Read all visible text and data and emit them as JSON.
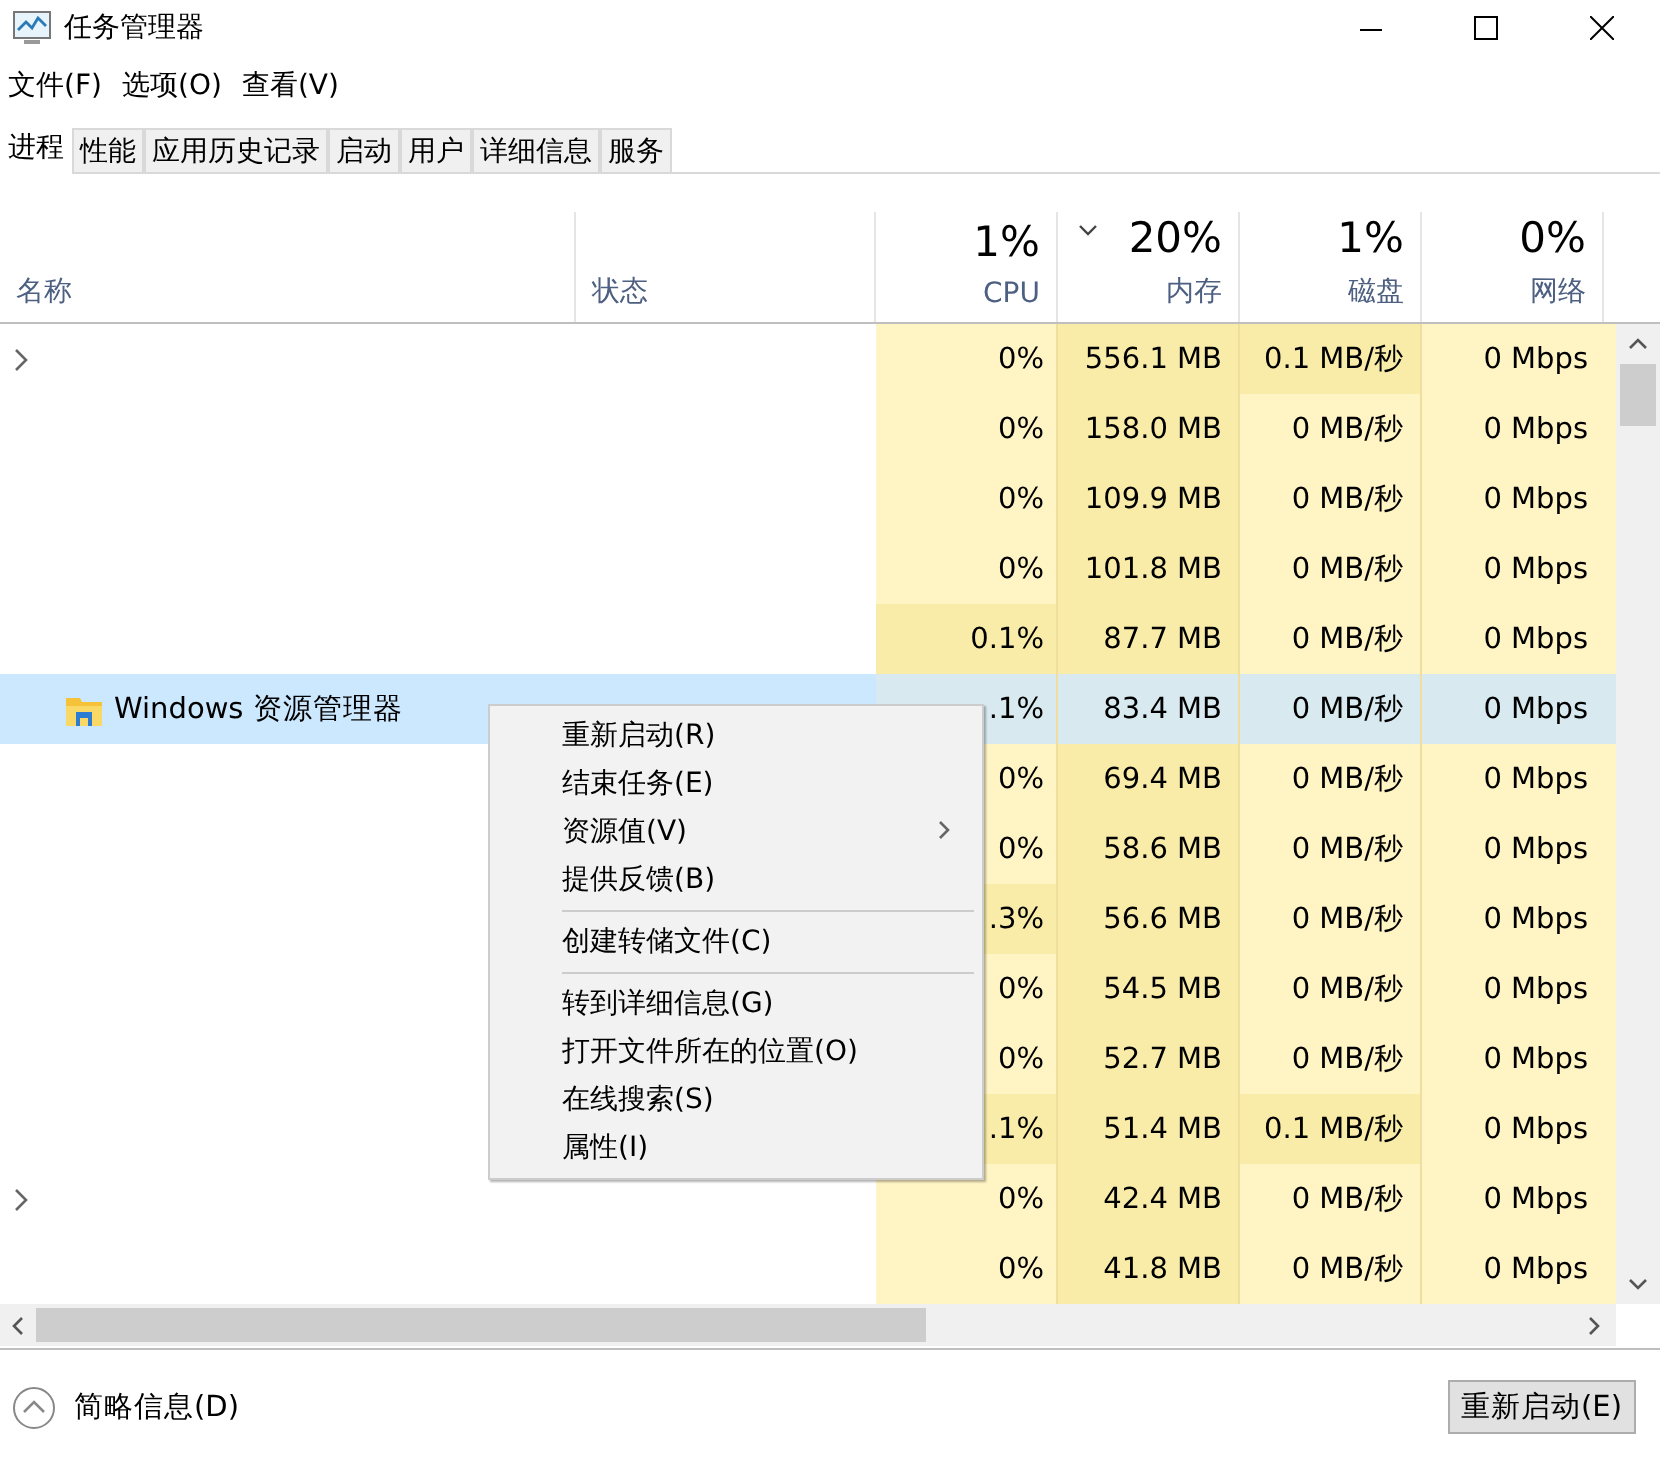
{
  "window": {
    "title": "任务管理器"
  },
  "menu_bar": [
    "文件(F)",
    "选项(O)",
    "查看(V)"
  ],
  "tabs": [
    {
      "label": "进程",
      "selected": true
    },
    {
      "label": "性能",
      "selected": false
    },
    {
      "label": "应用历史记录",
      "selected": false
    },
    {
      "label": "启动",
      "selected": false
    },
    {
      "label": "用户",
      "selected": false
    },
    {
      "label": "详细信息",
      "selected": false
    },
    {
      "label": "服务",
      "selected": false
    }
  ],
  "columns": [
    {
      "label": "名称"
    },
    {
      "label": "状态"
    },
    {
      "label": "CPU",
      "total": "1%",
      "sorted": false
    },
    {
      "label": "内存",
      "total": "20%",
      "sorted": true
    },
    {
      "label": "磁盘",
      "total": "1%",
      "sorted": false
    },
    {
      "label": "网络",
      "total": "0%",
      "sorted": false
    }
  ],
  "rows": [
    {
      "expandable": true,
      "selected": false,
      "cells": [
        {
          "text": "0%",
          "hot": false
        },
        {
          "text": "556.1 MB",
          "hot": true
        },
        {
          "text": "0.1 MB/秒",
          "hot": true
        },
        {
          "text": "0 Mbps",
          "hot": false
        }
      ]
    },
    {
      "expandable": false,
      "selected": false,
      "cells": [
        {
          "text": "0%",
          "hot": false
        },
        {
          "text": "158.0 MB",
          "hot": true
        },
        {
          "text": "0 MB/秒",
          "hot": false
        },
        {
          "text": "0 Mbps",
          "hot": false
        }
      ]
    },
    {
      "expandable": false,
      "selected": false,
      "cells": [
        {
          "text": "0%",
          "hot": false
        },
        {
          "text": "109.9 MB",
          "hot": true
        },
        {
          "text": "0 MB/秒",
          "hot": false
        },
        {
          "text": "0 Mbps",
          "hot": false
        }
      ]
    },
    {
      "expandable": false,
      "selected": false,
      "cells": [
        {
          "text": "0%",
          "hot": false
        },
        {
          "text": "101.8 MB",
          "hot": true
        },
        {
          "text": "0 MB/秒",
          "hot": false
        },
        {
          "text": "0 Mbps",
          "hot": false
        }
      ]
    },
    {
      "expandable": false,
      "selected": false,
      "cells": [
        {
          "text": "0.1%",
          "hot": true
        },
        {
          "text": "87.7 MB",
          "hot": true
        },
        {
          "text": "0 MB/秒",
          "hot": false
        },
        {
          "text": "0 Mbps",
          "hot": false
        }
      ]
    },
    {
      "name": "Windows 资源管理器",
      "expandable": false,
      "selected": true,
      "cells": [
        {
          "text": ".1%",
          "hot": false
        },
        {
          "text": "83.4 MB",
          "hot": false
        },
        {
          "text": "0 MB/秒",
          "hot": false
        },
        {
          "text": "0 Mbps",
          "hot": false
        }
      ]
    },
    {
      "expandable": false,
      "selected": false,
      "cells": [
        {
          "text": "0%",
          "hot": false
        },
        {
          "text": "69.4 MB",
          "hot": true
        },
        {
          "text": "0 MB/秒",
          "hot": false
        },
        {
          "text": "0 Mbps",
          "hot": false
        }
      ]
    },
    {
      "expandable": false,
      "selected": false,
      "cells": [
        {
          "text": "0%",
          "hot": false
        },
        {
          "text": "58.6 MB",
          "hot": true
        },
        {
          "text": "0 MB/秒",
          "hot": false
        },
        {
          "text": "0 Mbps",
          "hot": false
        }
      ]
    },
    {
      "expandable": false,
      "selected": false,
      "cells": [
        {
          "text": ".3%",
          "hot": true
        },
        {
          "text": "56.6 MB",
          "hot": true
        },
        {
          "text": "0 MB/秒",
          "hot": false
        },
        {
          "text": "0 Mbps",
          "hot": false
        }
      ]
    },
    {
      "expandable": false,
      "selected": false,
      "cells": [
        {
          "text": "0%",
          "hot": false
        },
        {
          "text": "54.5 MB",
          "hot": true
        },
        {
          "text": "0 MB/秒",
          "hot": false
        },
        {
          "text": "0 Mbps",
          "hot": false
        }
      ]
    },
    {
      "expandable": false,
      "selected": false,
      "cells": [
        {
          "text": "0%",
          "hot": false
        },
        {
          "text": "52.7 MB",
          "hot": true
        },
        {
          "text": "0 MB/秒",
          "hot": false
        },
        {
          "text": "0 Mbps",
          "hot": false
        }
      ]
    },
    {
      "expandable": false,
      "selected": false,
      "cells": [
        {
          "text": ".1%",
          "hot": true
        },
        {
          "text": "51.4 MB",
          "hot": true
        },
        {
          "text": "0.1 MB/秒",
          "hot": true
        },
        {
          "text": "0 Mbps",
          "hot": false
        }
      ]
    },
    {
      "expandable": true,
      "selected": false,
      "cells": [
        {
          "text": "0%",
          "hot": false
        },
        {
          "text": "42.4 MB",
          "hot": true
        },
        {
          "text": "0 MB/秒",
          "hot": false
        },
        {
          "text": "0 Mbps",
          "hot": false
        }
      ]
    },
    {
      "expandable": false,
      "selected": false,
      "cells": [
        {
          "text": "0%",
          "hot": false
        },
        {
          "text": "41.8 MB",
          "hot": true
        },
        {
          "text": "0 MB/秒",
          "hot": false
        },
        {
          "text": "0 Mbps",
          "hot": false
        }
      ]
    }
  ],
  "context_menu": {
    "groups": [
      [
        {
          "label": "重新启动(R)",
          "submenu": false
        },
        {
          "label": "结束任务(E)",
          "submenu": false
        },
        {
          "label": "资源值(V)",
          "submenu": true
        },
        {
          "label": "提供反馈(B)",
          "submenu": false
        }
      ],
      [
        {
          "label": "创建转储文件(C)",
          "submenu": false
        }
      ],
      [
        {
          "label": "转到详细信息(G)",
          "submenu": false
        },
        {
          "label": "打开文件所在的位置(O)",
          "submenu": false
        },
        {
          "label": "在线搜索(S)",
          "submenu": false
        },
        {
          "label": "属性(I)",
          "submenu": false
        }
      ]
    ]
  },
  "footer": {
    "details_toggle": "简略信息(D)",
    "button": "重新启动(E)"
  }
}
